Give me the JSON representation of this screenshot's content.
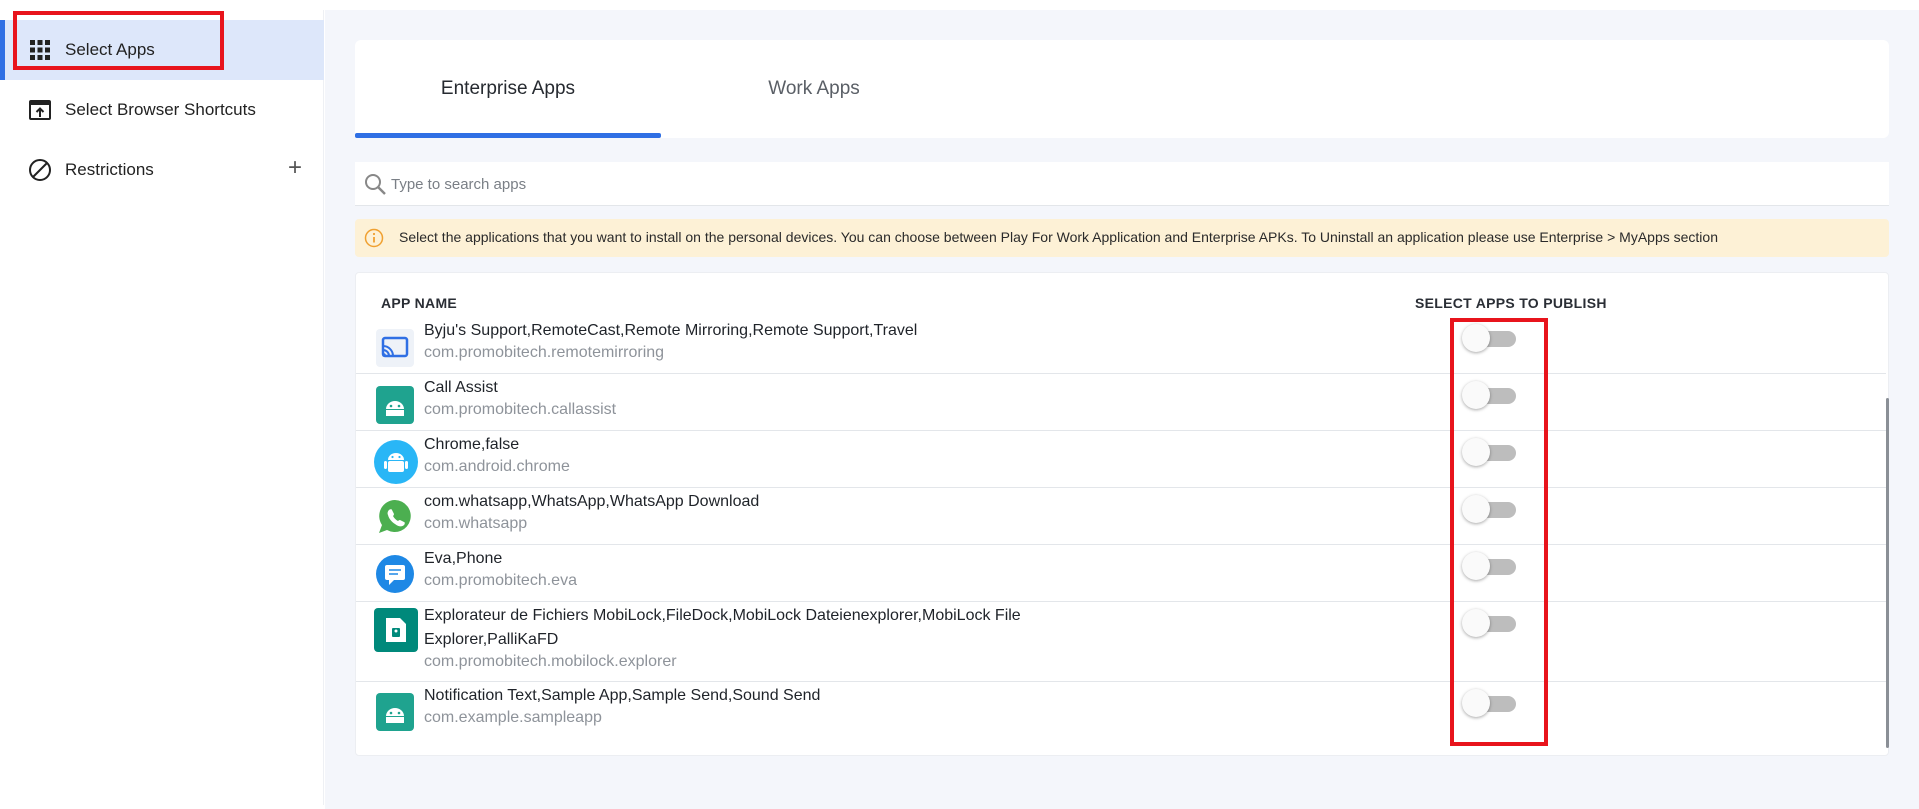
{
  "sidebar": {
    "items": [
      {
        "label": "Select Apps",
        "icon": "grid-icon",
        "active": true
      },
      {
        "label": "Select Browser Shortcuts",
        "icon": "browser-shortcut-icon",
        "active": false
      },
      {
        "label": "Restrictions",
        "icon": "block-icon",
        "active": false,
        "expand": "+"
      }
    ]
  },
  "tabs": [
    {
      "label": "Enterprise Apps",
      "active": true
    },
    {
      "label": "Work Apps",
      "active": false
    }
  ],
  "search": {
    "placeholder": "Type to search apps",
    "value": ""
  },
  "info": {
    "text": "Select the applications that you want to install on the personal devices. You can choose between Play For Work Application and Enterprise APKs. To Uninstall an application please use Enterprise > MyApps section"
  },
  "table": {
    "headers": {
      "app_name": "APP NAME",
      "publish": "SELECT APPS TO PUBLISH"
    },
    "rows": [
      {
        "name": "Byju's Support,RemoteCast,Remote Mirroring,Remote Support,Travel",
        "name2": "",
        "package": "com.promobitech.remotemirroring",
        "icon": "cast-icon",
        "published": false
      },
      {
        "name": "Call Assist",
        "name2": "",
        "package": "com.promobitech.callassist",
        "icon": "android-icon",
        "published": false
      },
      {
        "name": "Chrome,false",
        "name2": "",
        "package": "com.android.chrome",
        "icon": "android-robot-icon",
        "published": false
      },
      {
        "name": "com.whatsapp,WhatsApp,WhatsApp Download",
        "name2": "",
        "package": "com.whatsapp",
        "icon": "whatsapp-icon",
        "published": false
      },
      {
        "name": "Eva,Phone",
        "name2": "",
        "package": "com.promobitech.eva",
        "icon": "chat-icon",
        "published": false
      },
      {
        "name": "Explorateur de Fichiers MobiLock,FileDock,MobiLock Dateienexplorer,MobiLock File",
        "name2": "Explorer,PalliKaFD",
        "package": "com.promobitech.mobilock.explorer",
        "icon": "file-explorer-icon",
        "published": false
      },
      {
        "name": "Notification Text,Sample App,Sample Send,Sound Send",
        "name2": "",
        "package": "com.example.sampleapp",
        "icon": "android-icon",
        "published": false
      }
    ]
  },
  "colors": {
    "accent": "#2f6fe4",
    "highlight": "#e8141c",
    "info_bg": "#fdf1d6",
    "info_icon": "#f0a030"
  }
}
